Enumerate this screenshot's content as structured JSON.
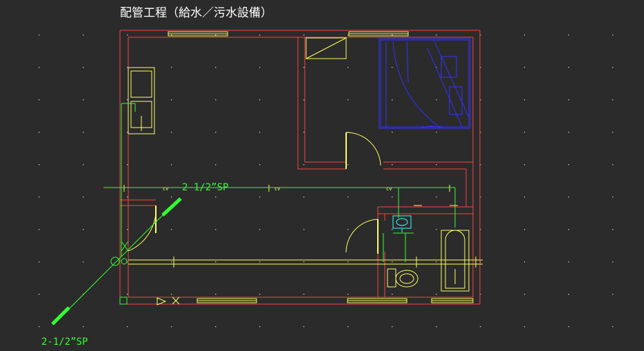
{
  "drawing": {
    "title": "配管工程（給水／污水設備）",
    "pipe_labels": {
      "main": "2-1/2”SP",
      "lower": "2-1/2”SP"
    },
    "valve_labels": [
      "cv",
      "cv",
      "cv"
    ]
  },
  "colors": {
    "background": "#2b2b2b",
    "wall": "#ff4040",
    "fixture": "#ffff66",
    "pipe": "#33ff33",
    "furniture": "#3333ff",
    "sink": "#33ffff",
    "grid_dot": "#bbbbbb"
  }
}
